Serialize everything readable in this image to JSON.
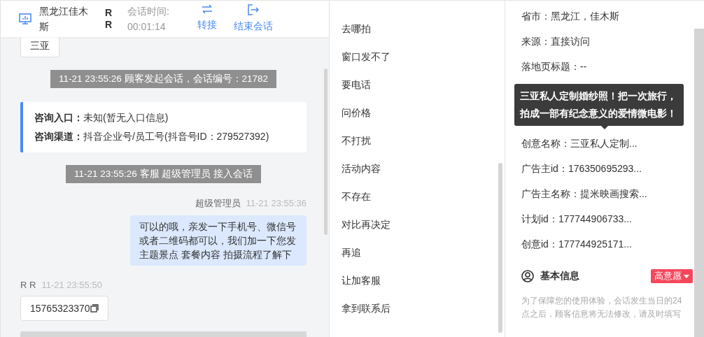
{
  "header": {
    "location": "黑龙江佳木斯",
    "customer": "R R",
    "duration_label": "会话时间:",
    "duration": "00:01:14",
    "actions": [
      {
        "kind": "transfer",
        "label": "转接"
      },
      {
        "kind": "exit",
        "label": "结束会话"
      }
    ]
  },
  "chat": {
    "messages": [
      {
        "kind": "cut_bubble",
        "text": "三亚"
      },
      {
        "kind": "system",
        "text": "11-21 23:55:26 顾客发起会话，会话编号：21782"
      },
      {
        "kind": "entry_card",
        "lines": [
          "**咨询入口：**未知(暂无入口信息)",
          "**咨询渠道：**抖音企业号/员工号(抖音号ID：279527392)"
        ]
      },
      {
        "kind": "system",
        "text": "11-21 23:55:26 客服 超级管理员 接入会话"
      },
      {
        "kind": "agent",
        "sender": "超级管理员",
        "time": "11-21 23:55:36",
        "text": "可以的哦，亲发一下手机号、微信号或者二维码都可以，我们加一下您发主题景点 套餐内容 拍摄流程了解下"
      },
      {
        "kind": "customer",
        "sender": "R R",
        "time": "11-21 23:55:50",
        "text": "15765323370"
      }
    ]
  },
  "quick_replies": [
    "去哪拍",
    "窗口发不了",
    "要电话",
    "问价格",
    "不打扰",
    "活动内容",
    "不存在",
    "对比再决定",
    "再追",
    "让加客服",
    "拿到联系后"
  ],
  "info": {
    "rows_top": [
      "省市：黑龙江，佳木斯",
      "来源：直接访问",
      "落地页标题：--"
    ],
    "tooltip": "三亚私人定制婚纱照！把一次旅行，拍成一部有纪念意义的爱情微电影！",
    "rows_bottom": [
      "创意名称：三亚私人定制...",
      "广告主id：176350695293...",
      "广告主名称：提米映画搜索...",
      "计划id：177744906733...",
      "创意id：177744925171..."
    ],
    "section": {
      "title": "基本信息",
      "tag": "高意愿"
    },
    "notice": "为了保障您的使用体验，会话发生当日的24点之后，顾客信息将无法修改，请及时填写"
  }
}
